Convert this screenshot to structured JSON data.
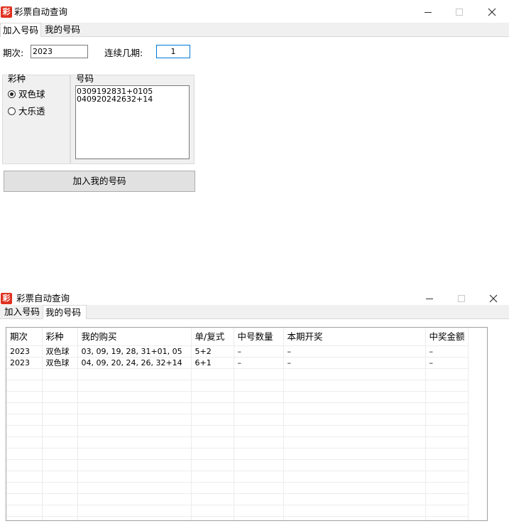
{
  "app": {
    "title": "彩票自动查询",
    "icon_glyph": "彩",
    "icon_color": "#e0301e"
  },
  "tabs": [
    "加入号码",
    "我的号码"
  ],
  "add_form": {
    "period_label": "期次:",
    "period_value": "2023",
    "consecutive_label": "连续几期:",
    "consecutive_value": "1",
    "lottery_group_title": "彩种",
    "lottery_options": [
      {
        "label": "双色球",
        "selected": true
      },
      {
        "label": "大乐透",
        "selected": false
      }
    ],
    "numbers_group_title": "号码",
    "numbers_lines": [
      "0309192831+0105",
      "040920242632+14"
    ],
    "add_button_label": "加入我的号码"
  },
  "my_numbers": {
    "columns": [
      "期次",
      "彩种",
      "我的购买",
      "单/复式",
      "中号数量",
      "本期开奖",
      "中奖金额"
    ],
    "rows": [
      [
        "2023",
        "双色球",
        "03, 09, 19, 28, 31+01, 05",
        "5+2",
        "–",
        "–",
        "–"
      ],
      [
        "2023",
        "双色球",
        "04, 09, 20, 24, 26, 32+14",
        "6+1",
        "–",
        "–",
        "–"
      ]
    ],
    "empty_rows": 14
  }
}
